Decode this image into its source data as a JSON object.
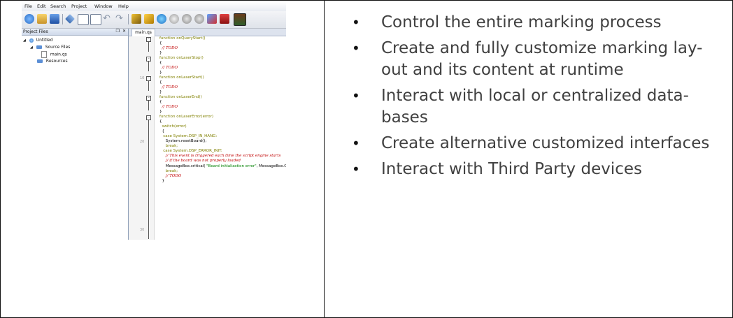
{
  "ide": {
    "menu": [
      "File",
      "Edit",
      "Search",
      "Project",
      "Window",
      "Help"
    ],
    "panel_title": "Project Files",
    "panel_pin": "❒",
    "panel_close": "✕",
    "tree": [
      {
        "label": "Untitled",
        "icon": "globe-icon"
      },
      {
        "label": "Source Files",
        "icon": "folder-icon"
      },
      {
        "label": "main.qs",
        "icon": "file-icon"
      },
      {
        "label": "Resources",
        "icon": "folder-icon"
      }
    ],
    "tab": "main.qs",
    "line_numbers": [
      "10",
      "20",
      "30"
    ],
    "code": [
      {
        "kind": "kw",
        "text": "function onQueryStart()"
      },
      {
        "kind": "plain",
        "text": "{"
      },
      {
        "kind": "cm",
        "text": "  // TODO"
      },
      {
        "kind": "plain",
        "text": "}"
      },
      {
        "kind": "kw",
        "text": "function onLaserStop()"
      },
      {
        "kind": "plain",
        "text": "{"
      },
      {
        "kind": "cm",
        "text": "  // TODO"
      },
      {
        "kind": "plain",
        "text": "}"
      },
      {
        "kind": "kw",
        "text": "function onLaserStart()"
      },
      {
        "kind": "plain",
        "text": "{"
      },
      {
        "kind": "cm",
        "text": "  // TODO"
      },
      {
        "kind": "plain",
        "text": "}"
      },
      {
        "kind": "kw",
        "text": "function onLaserEnd()"
      },
      {
        "kind": "plain",
        "text": "{"
      },
      {
        "kind": "cm",
        "text": "  // TODO"
      },
      {
        "kind": "plain",
        "text": "}"
      },
      {
        "kind": "kw",
        "text": "function onLaserError(error)"
      },
      {
        "kind": "plain",
        "text": "{"
      },
      {
        "kind": "kw",
        "text": "  switch(error)"
      },
      {
        "kind": "plain",
        "text": "  {"
      },
      {
        "kind": "kw",
        "text": "   case System.DSP_IN_HANG:"
      },
      {
        "kind": "plain",
        "text": "     System.resetBoard();"
      },
      {
        "kind": "kw",
        "text": "     break;"
      },
      {
        "kind": "kw",
        "text": "   case System.DSP_ERROR_INIT:"
      },
      {
        "kind": "cm",
        "text": "     // This event is triggered each time the script engine starts"
      },
      {
        "kind": "cm",
        "text": "     // if the board was not properly loaded"
      },
      {
        "kind": "mb",
        "pre": "     MessageBox.critical( ",
        "str": "\"Board initialization error\"",
        "post": ", MessageBox.Ok );"
      },
      {
        "kind": "kw",
        "text": "     break;"
      },
      {
        "kind": "cm",
        "text": "     // TODO"
      },
      {
        "kind": "plain",
        "text": "  }"
      }
    ]
  },
  "bullets": [
    {
      "lines": [
        "Control the entire marking process"
      ]
    },
    {
      "lines": [
        "Create and fully customize marking lay-",
        "out and its content at runtime"
      ]
    },
    {
      "lines": [
        "Interact with local or centralized data-",
        "bases"
      ]
    },
    {
      "lines": [
        "Create alternative customized interfaces"
      ]
    },
    {
      "lines": [
        "Interact with Third Party devices"
      ]
    }
  ],
  "bullet_glyph": "•",
  "colors": {
    "keyword": "#808000",
    "comment": "#c00000",
    "string": "#008000",
    "bullet_text": "#404040"
  }
}
